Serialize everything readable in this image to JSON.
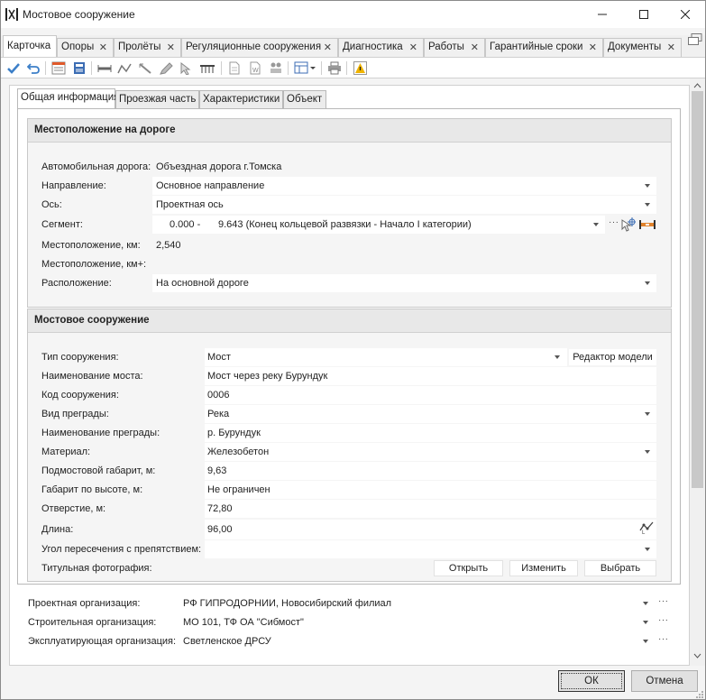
{
  "window": {
    "title": "Мостовое сооружение"
  },
  "tabs": [
    {
      "label": "Карточка"
    },
    {
      "label": "Опоры"
    },
    {
      "label": "Пролёты"
    },
    {
      "label": "Регуляционные сооружения"
    },
    {
      "label": "Диагностика"
    },
    {
      "label": "Работы"
    },
    {
      "label": "Гарантийные сроки"
    },
    {
      "label": "Документы"
    }
  ],
  "inner_tabs": [
    {
      "label": "Общая информация"
    },
    {
      "label": "Проезжая часть"
    },
    {
      "label": "Характеристики"
    },
    {
      "label": "Объект"
    }
  ],
  "location": {
    "header": "Местоположение на дороге",
    "road_label": "Автомобильная дорога:",
    "road_value": "Объездная дорога г.Томска",
    "direction_label": "Направление:",
    "direction_value": "Основное направление",
    "axis_label": "Ось:",
    "axis_value": "Проектная ось",
    "segment_label": "Сегмент:",
    "segment_start": "0.000 -",
    "segment_value": "9.643 (Конец кольцевой развязки - Начало I категории)",
    "km_label": "Местоположение, км:",
    "km_value": "2,540",
    "kmplus_label": "Местоположение, км+:",
    "kmplus_value": "",
    "placement_label": "Расположение:",
    "placement_value": "На основной дороге"
  },
  "bridge": {
    "header": "Мостовое сооружение",
    "type_label": "Тип сооружения:",
    "type_value": "Мост",
    "model_editor": "Редактор модели",
    "name_label": "Наименование моста:",
    "name_value": "Мост через реку Бурундук",
    "code_label": "Код сооружения:",
    "code_value": "0006",
    "barrier_type_label": "Вид преграды:",
    "barrier_type_value": "Река",
    "barrier_name_label": "Наименование преграды:",
    "barrier_name_value": "р. Бурундук",
    "material_label": "Материал:",
    "material_value": "Железобетон",
    "clearance_label": "Подмостовой габарит, м:",
    "clearance_value": "9,63",
    "height_label": "Габарит по высоте, м:",
    "height_value": "Не ограничен",
    "opening_label": "Отверстие, м:",
    "opening_value": "72,80",
    "length_label": "Длина:",
    "length_value": "96,00",
    "angle_label": "Угол пересечения с препятствием:",
    "angle_value": "",
    "photo_label": "Титульная фотография:",
    "open_btn": "Открыть",
    "change_btn": "Изменить",
    "choose_btn": "Выбрать"
  },
  "orgs": {
    "design_label": "Проектная организация:",
    "design_value": "РФ ГИПРОДОРНИИ, Новосибирский филиал",
    "build_label": "Строительная организация:",
    "build_value": "МО 101, ТФ ОА \"Сибмост\"",
    "operate_label": "Эксплуатирующая организация:",
    "operate_value": "Светленское ДРСУ"
  },
  "dialog": {
    "ok": "ОК",
    "cancel": "Отмена"
  }
}
